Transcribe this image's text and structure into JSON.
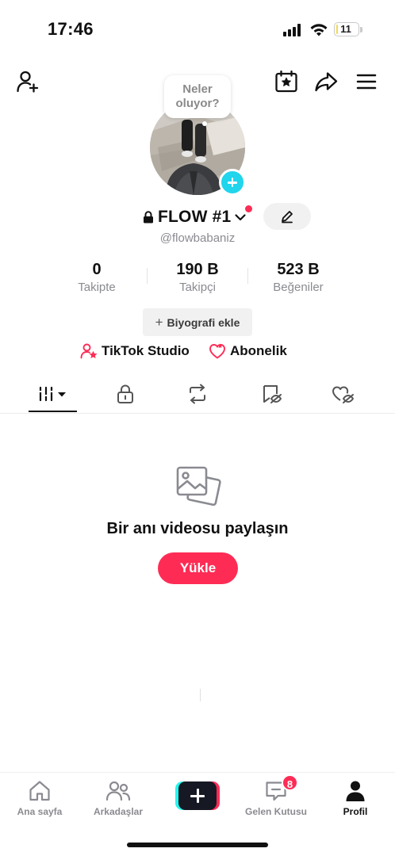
{
  "status_bar": {
    "time": "17:46",
    "battery": "11",
    "battery_level": 0.11
  },
  "profile": {
    "note_line1": "Neler",
    "note_line2": "oluyor?",
    "display_name": "FLOW #1",
    "username": "@flowbabaniz"
  },
  "stats": [
    {
      "value": "0",
      "label": "Takipte"
    },
    {
      "value": "190 B",
      "label": "Takipçi"
    },
    {
      "value": "523 B",
      "label": "Beğeniler"
    }
  ],
  "bio_button": {
    "plus": "+",
    "label": "Biyografi ekle"
  },
  "links": {
    "studio": "TikTok Studio",
    "subscription": "Abonelik"
  },
  "empty_state": {
    "title": "Bir anı videosu paylaşın",
    "button": "Yükle"
  },
  "bottom_nav": {
    "home": "Ana sayfa",
    "friends": "Arkadaşlar",
    "inbox": "Gelen Kutusu",
    "inbox_badge": "8",
    "profile": "Profil"
  },
  "colors": {
    "accent": "#fe2c55",
    "cyan": "#20d5ec",
    "muted": "#8a8b91"
  }
}
